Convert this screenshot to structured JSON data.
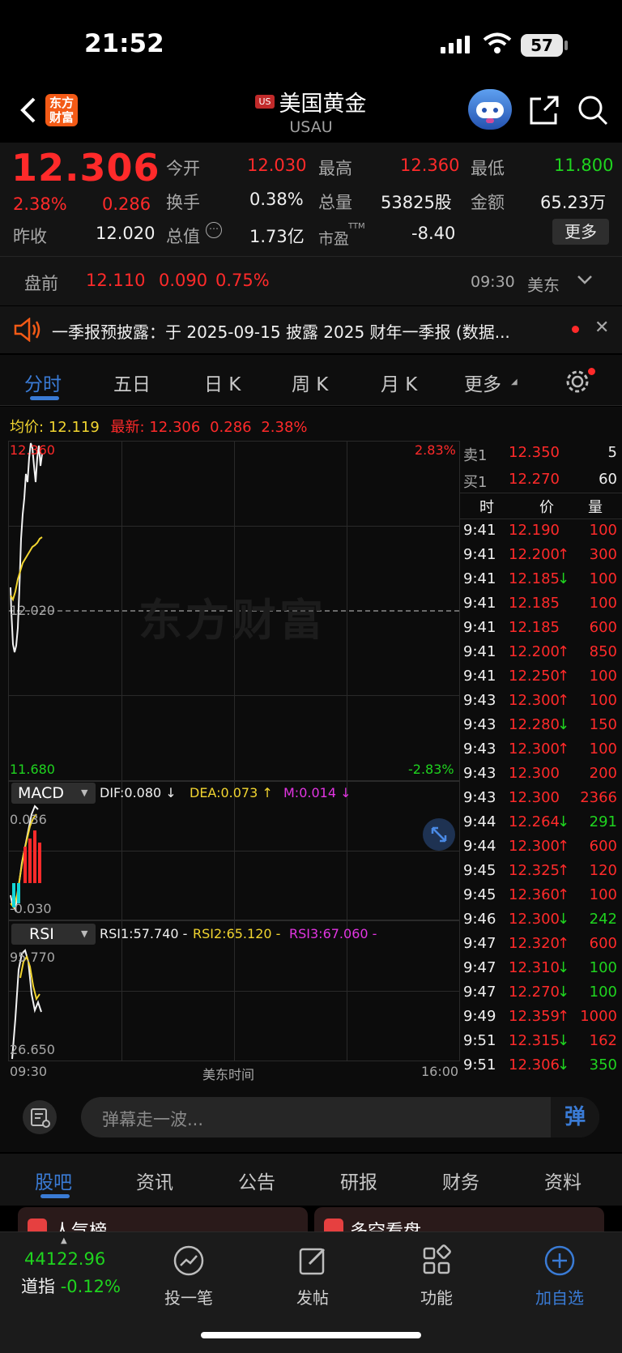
{
  "status": {
    "time": "21:52",
    "battery": "57"
  },
  "header": {
    "back_icon": "chevron-left-icon",
    "logo_line1": "东方",
    "logo_line2": "财富",
    "market_badge": "US",
    "title": "美国黄金",
    "subtitle": "USAU"
  },
  "quote": {
    "price": "12.306",
    "change_pct": "2.38%",
    "change": "0.286",
    "open_label": "今开",
    "open": "12.030",
    "high_label": "最高",
    "high": "12.360",
    "low_label": "最低",
    "low": "11.800",
    "turnover_label": "换手",
    "turnover": "0.38%",
    "volume_label": "总量",
    "volume": "53825股",
    "amount_label": "金额",
    "amount": "65.23万",
    "prev_close_label": "昨收",
    "prev_close": "12.020",
    "mkt_cap_label": "总值",
    "mkt_cap": "1.73亿",
    "pe_label": "市盈",
    "pe_sup": "TTM",
    "pe": "-8.40",
    "more_label": "更多"
  },
  "premarket": {
    "label": "盘前",
    "price": "12.110",
    "change": "0.090",
    "change_pct": "0.75%",
    "time": "09:30",
    "zone": "美东"
  },
  "announcement": {
    "text": "一季报预披露：于 2025-09-15 披露 2025 财年一季报 (数据..."
  },
  "tabs": [
    {
      "label": "分时",
      "active": true
    },
    {
      "label": "五日"
    },
    {
      "label": "日 K"
    },
    {
      "label": "周 K"
    },
    {
      "label": "月 K"
    },
    {
      "label": "更多"
    }
  ],
  "chart_info": {
    "avg_label": "均价:",
    "avg": "12.119",
    "latest_label": "最新:",
    "latest": "12.306",
    "latest_change": "0.286",
    "latest_pct": "2.38%",
    "y_top": "12.360",
    "y_mid": "12.020",
    "y_bottom": "11.680",
    "pct_top": "2.83%",
    "pct_bottom": "-2.83%",
    "watermark": "东方财富",
    "x_start": "09:30",
    "x_mid": "美东时间",
    "x_end": "16:00"
  },
  "macd": {
    "selector": "MACD",
    "dif": "DIF:0.080 ↓",
    "dea": "DEA:0.073 ↑",
    "m": "M:0.014 ↓",
    "top": "0.036",
    "bottom": "-0.030"
  },
  "rsi": {
    "selector": "RSI",
    "rsi1": "RSI1:57.740 -",
    "rsi2": "RSI2:65.120 -",
    "rsi3": "RSI3:67.060 -",
    "top": "95.770",
    "bottom": "26.650"
  },
  "orderbook": {
    "sell_label": "卖1",
    "sell_price": "12.350",
    "sell_qty": "5",
    "buy_label": "买1",
    "buy_price": "12.270",
    "buy_qty": "60",
    "col_time": "时",
    "col_price": "价",
    "col_qty": "量"
  },
  "trades": [
    {
      "t": "9:41",
      "p": "12.190",
      "dir": "",
      "q": "100",
      "qc": "red"
    },
    {
      "t": "9:41",
      "p": "12.200",
      "dir": "↑",
      "q": "300",
      "qc": "red"
    },
    {
      "t": "9:41",
      "p": "12.185",
      "dir": "↓",
      "q": "100",
      "qc": "red"
    },
    {
      "t": "9:41",
      "p": "12.185",
      "dir": "",
      "q": "100",
      "qc": "red"
    },
    {
      "t": "9:41",
      "p": "12.185",
      "dir": "",
      "q": "600",
      "qc": "red"
    },
    {
      "t": "9:41",
      "p": "12.200",
      "dir": "↑",
      "q": "850",
      "qc": "red"
    },
    {
      "t": "9:41",
      "p": "12.250",
      "dir": "↑",
      "q": "100",
      "qc": "red"
    },
    {
      "t": "9:43",
      "p": "12.300",
      "dir": "↑",
      "q": "100",
      "qc": "red"
    },
    {
      "t": "9:43",
      "p": "12.280",
      "dir": "↓",
      "q": "150",
      "qc": "red"
    },
    {
      "t": "9:43",
      "p": "12.300",
      "dir": "↑",
      "q": "100",
      "qc": "red"
    },
    {
      "t": "9:43",
      "p": "12.300",
      "dir": "",
      "q": "200",
      "qc": "red"
    },
    {
      "t": "9:43",
      "p": "12.300",
      "dir": "",
      "q": "2366",
      "qc": "red"
    },
    {
      "t": "9:44",
      "p": "12.264",
      "dir": "↓",
      "q": "291",
      "qc": "green"
    },
    {
      "t": "9:44",
      "p": "12.300",
      "dir": "↑",
      "q": "600",
      "qc": "red"
    },
    {
      "t": "9:45",
      "p": "12.325",
      "dir": "↑",
      "q": "120",
      "qc": "red"
    },
    {
      "t": "9:45",
      "p": "12.360",
      "dir": "↑",
      "q": "100",
      "qc": "red"
    },
    {
      "t": "9:46",
      "p": "12.300",
      "dir": "↓",
      "q": "242",
      "qc": "green"
    },
    {
      "t": "9:47",
      "p": "12.320",
      "dir": "↑",
      "q": "600",
      "qc": "red"
    },
    {
      "t": "9:47",
      "p": "12.310",
      "dir": "↓",
      "q": "100",
      "qc": "green"
    },
    {
      "t": "9:47",
      "p": "12.270",
      "dir": "↓",
      "q": "100",
      "qc": "green"
    },
    {
      "t": "9:49",
      "p": "12.359",
      "dir": "↑",
      "q": "1000",
      "qc": "red"
    },
    {
      "t": "9:51",
      "p": "12.315",
      "dir": "↓",
      "q": "162",
      "qc": "red"
    },
    {
      "t": "9:51",
      "p": "12.306",
      "dir": "↓",
      "q": "350",
      "qc": "green"
    }
  ],
  "danmu": {
    "placeholder": "弹幕走一波...",
    "send": "弹"
  },
  "bottom_tabs": [
    {
      "label": "股吧",
      "active": true
    },
    {
      "label": "资讯"
    },
    {
      "label": "公告"
    },
    {
      "label": "研报"
    },
    {
      "label": "财务"
    },
    {
      "label": "资料"
    }
  ],
  "cards": {
    "left": "人气榜",
    "right": "多空看盘"
  },
  "nav": {
    "index_value": "44122.96",
    "index_name": "道指",
    "index_change": "-0.12%",
    "items": [
      {
        "label": "投一笔",
        "icon": "trend-chart-icon"
      },
      {
        "label": "发帖",
        "icon": "edit-icon"
      },
      {
        "label": "功能",
        "icon": "grid-icon"
      },
      {
        "label": "加自选",
        "icon": "add-circle-icon"
      }
    ]
  },
  "colors": {
    "up": "#ff2a2a",
    "down": "#1fd41f",
    "accent": "#3a7bd5",
    "avg_line": "#f2d530"
  }
}
